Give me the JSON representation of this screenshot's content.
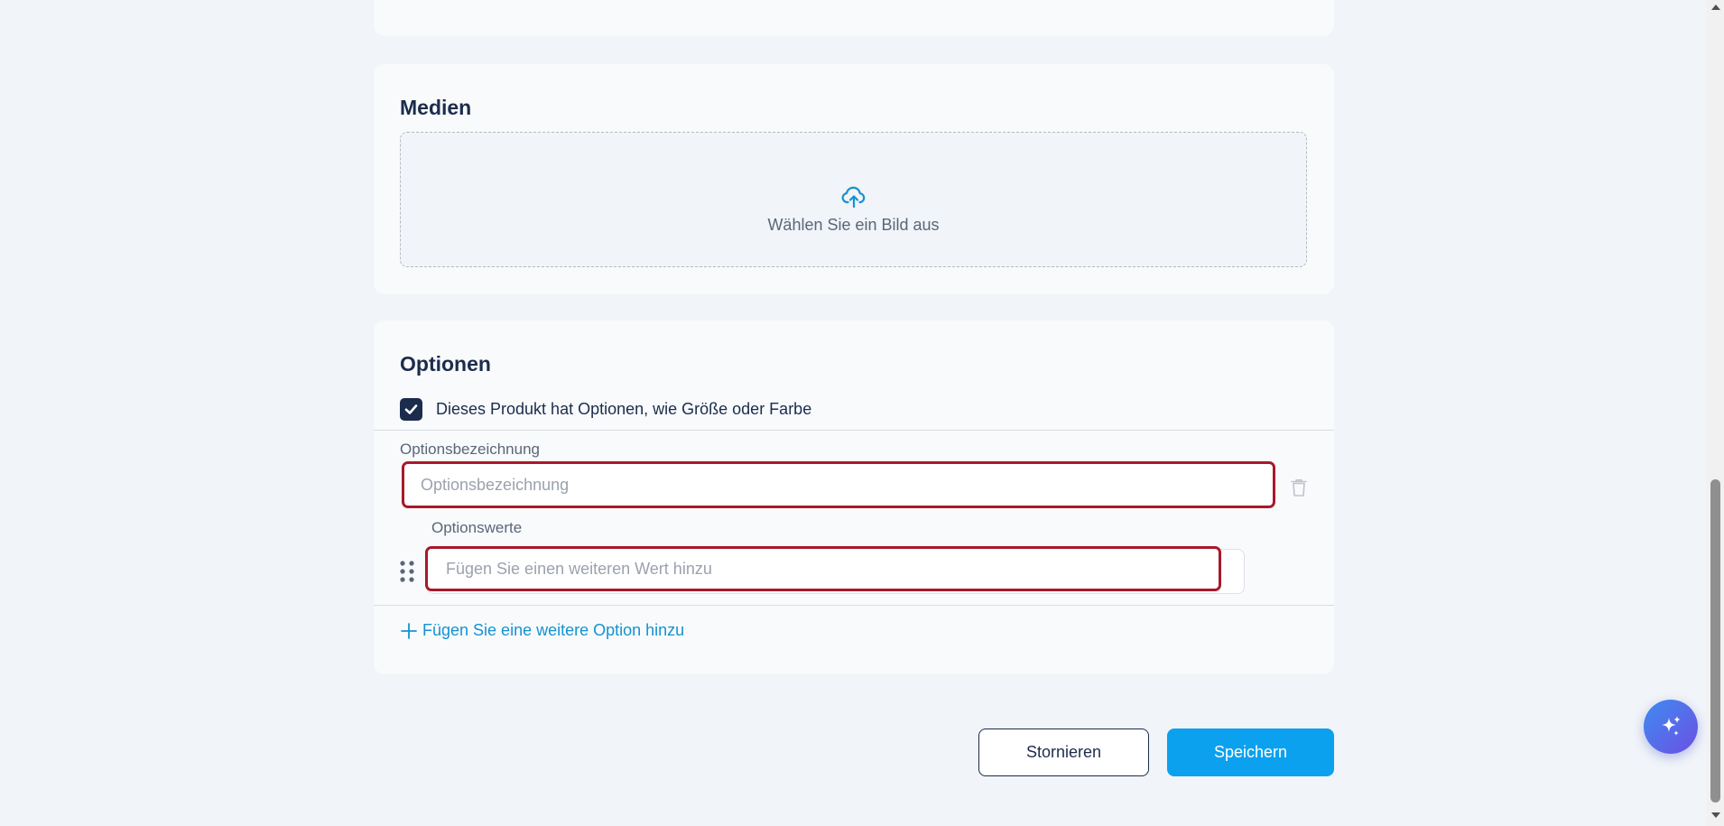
{
  "media": {
    "title": "Medien",
    "upload_label": "Wählen Sie ein Bild aus"
  },
  "options": {
    "title": "Optionen",
    "has_options_label": "Dieses Produkt hat Optionen, wie Größe oder Farbe",
    "has_options_checked": true,
    "option_name_label": "Optionsbezeichnung",
    "option_name_placeholder": "Optionsbezeichnung",
    "option_name_value": "",
    "option_values_label": "Optionswerte",
    "option_value_placeholder": "Fügen Sie einen weiteren Wert hinzu",
    "option_value_value": "",
    "add_option_label": "Fügen Sie eine weitere Option hinzu"
  },
  "actions": {
    "cancel_label": "Stornieren",
    "save_label": "Speichern"
  },
  "colors": {
    "primary": "#0ba1ef",
    "navy": "#1c2c4c",
    "error_border": "#a8192a",
    "link": "#1592d0"
  },
  "icons": {
    "upload": "cloud-upload-icon",
    "checkbox": "check-icon",
    "delete": "trash-icon",
    "drag": "drag-handle-icon",
    "add": "plus-icon",
    "ai": "sparkles-icon"
  }
}
